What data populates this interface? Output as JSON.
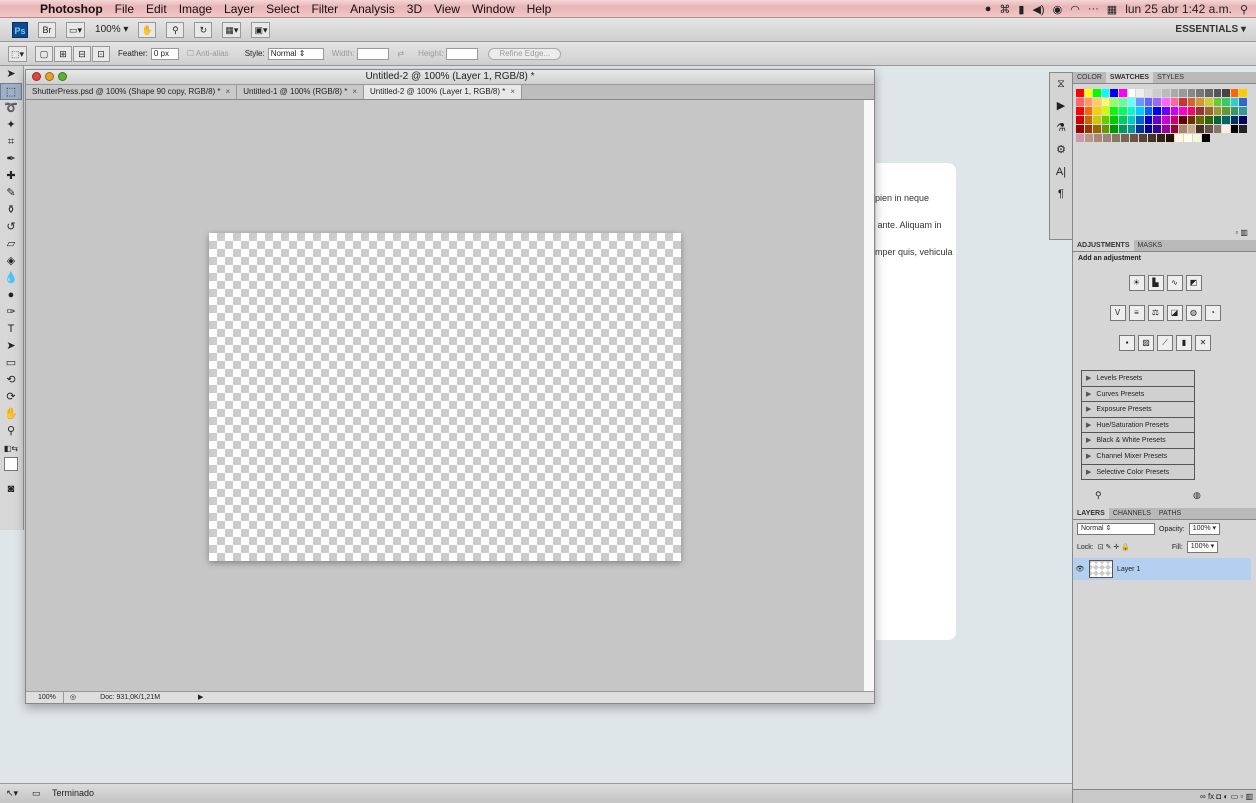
{
  "menubar": {
    "app": "Photoshop",
    "items": [
      "File",
      "Edit",
      "Image",
      "Layer",
      "Select",
      "Filter",
      "Analysis",
      "3D",
      "View",
      "Window",
      "Help"
    ],
    "clock": "lun 25 abr  1:42 a.m."
  },
  "appbar": {
    "ps": "Ps",
    "br": "Br",
    "zoom": "100%",
    "workspace": "ESSENTIALS ▾"
  },
  "options": {
    "feather_label": "Feather:",
    "feather_value": "0 px",
    "antialias": "Anti-alias",
    "style_label": "Style:",
    "style_value": "Normal",
    "width_label": "Width:",
    "height_label": "Height:",
    "refine": "Refine Edge..."
  },
  "document": {
    "title": "Untitled-2 @ 100% (Layer 1, RGB/8) *",
    "tabs": [
      {
        "label": "ShutterPress.psd @ 100% (Shape 90 copy, RGB/8) *"
      },
      {
        "label": "Untitled-1 @ 100% (RGB/8) *"
      },
      {
        "label": "Untitled-2 @ 100% (Layer 1, RGB/8) *"
      }
    ],
    "zoom": "100%",
    "doc_info": "Doc: 931,0K/1,21M"
  },
  "background_page": {
    "lines": [
      "apien in neque",
      "n ante. Aliquam in",
      "emper quis, vehicula"
    ]
  },
  "panels": {
    "swatch_tabs": [
      "COLOR",
      "SWATCHES",
      "STYLES"
    ],
    "adjust_tabs": [
      "ADJUSTMENTS",
      "MASKS"
    ],
    "add_adjustment": "Add an adjustment",
    "presets": [
      "Levels Presets",
      "Curves Presets",
      "Exposure Presets",
      "Hue/Saturation Presets",
      "Black & White Presets",
      "Channel Mixer Presets",
      "Selective Color Presets"
    ],
    "layer_tabs": [
      "LAYERS",
      "CHANNELS",
      "PATHS"
    ],
    "blend_mode": "Normal",
    "opacity_label": "Opacity:",
    "opacity_value": "100%",
    "lock_label": "Lock:",
    "fill_label": "Fill:",
    "fill_value": "100%",
    "layer_name": "Layer 1"
  },
  "statusbar": {
    "text": "Terminado"
  },
  "colors": {
    "selected_layer": "#b4cff0",
    "canvas_bg": "#c6c6c6"
  }
}
